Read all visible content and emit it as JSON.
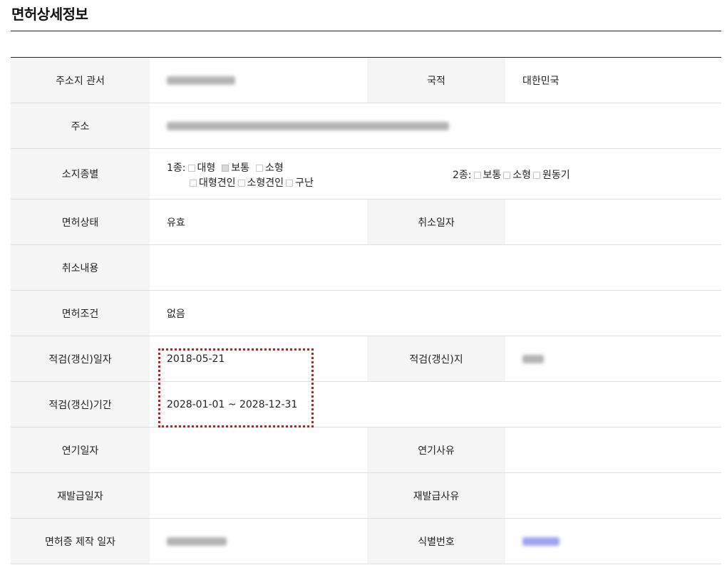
{
  "page": {
    "title": "면허상세정보"
  },
  "rows": {
    "address_office": {
      "label": "주소지 관서",
      "nationality_label": "국적",
      "nationality_value": "대한민국"
    },
    "address": {
      "label": "주소"
    },
    "license_types": {
      "label": "소지종별",
      "class1_prefix": "1종:",
      "class1_items": [
        {
          "label": "대형",
          "checked": false
        },
        {
          "label": "보통",
          "checked": true
        },
        {
          "label": "소형",
          "checked": false
        },
        {
          "label": "대형견인",
          "checked": false
        },
        {
          "label": "소형견인",
          "checked": false
        },
        {
          "label": "구난",
          "checked": false
        }
      ],
      "class2_prefix": "2종:",
      "class2_items": [
        {
          "label": "보통",
          "checked": false
        },
        {
          "label": "소형",
          "checked": false
        },
        {
          "label": "원동기",
          "checked": false
        }
      ]
    },
    "status": {
      "label": "면허상태",
      "value": "유효",
      "cancel_date_label": "취소일자"
    },
    "cancel_reason": {
      "label": "취소내용"
    },
    "conditions": {
      "label": "면허조건",
      "value": "없음"
    },
    "renewal_date": {
      "label": "적검(갱신)일자",
      "value": "2018-05-21",
      "place_label": "적검(갱신)지"
    },
    "renewal_period": {
      "label": "적검(갱신)기간",
      "value": "2028-01-01 ~ 2028-12-31"
    },
    "postpone": {
      "date_label": "연기일자",
      "reason_label": "연기사유"
    },
    "reissue": {
      "date_label": "재발급일자",
      "reason_label": "재발급사유"
    },
    "card": {
      "date_label": "면허증 제작 일자",
      "id_label": "식별번호"
    }
  },
  "colors": {
    "highlight": "#e01010",
    "header_bg": "#f5f5f5",
    "redacted_id": "#9fa3f0"
  }
}
